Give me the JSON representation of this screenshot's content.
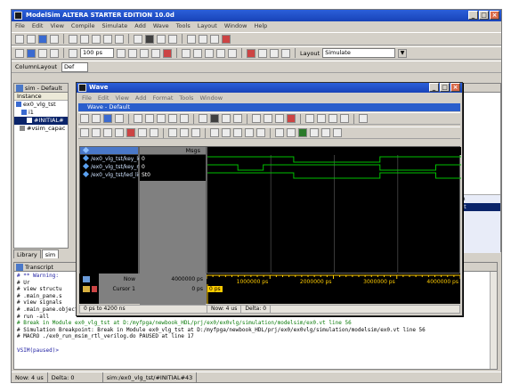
{
  "main": {
    "title": "ModelSim ALTERA STARTER EDITION 10.0d",
    "menu": [
      "File",
      "Edit",
      "View",
      "Compile",
      "Simulate",
      "Add",
      "Wave",
      "Tools",
      "Layout",
      "Window",
      "Help"
    ],
    "run_length": "100 ps",
    "layout_label": "Layout",
    "layout_value": "Simulate",
    "column_layout": "ColumnLayout",
    "column_layout_value": "Def"
  },
  "sim_pane": {
    "title": "sim - Default",
    "column": "Instance",
    "items": [
      "ex0_vlg_tst",
      "i1",
      "#INITIAL#",
      "#vsim_capac"
    ]
  },
  "left_tabs": [
    "Library",
    "sim"
  ],
  "right_pane": {
    "header": "ath",
    "row": "_tst"
  },
  "transcript": {
    "title": "Transcript",
    "lines": [
      {
        "text": "# ** Warning:",
        "cls": "blue"
      },
      {
        "text": "#           Ur",
        "cls": ""
      },
      {
        "text": "# view structu",
        "cls": ""
      },
      {
        "text": "# .main_pane.s",
        "cls": ""
      },
      {
        "text": "# view signals",
        "cls": ""
      },
      {
        "text": "# .main_pane.objects.interior.cs.body.tree",
        "cls": ""
      },
      {
        "text": "# run -all",
        "cls": ""
      },
      {
        "text": "# Break in Module ex0_vlg_tst at D:/myfpga/newbook_HDL/prj/ex0/ex0vlg/simulation/modelsim/ex0.vt line 56",
        "cls": "green"
      },
      {
        "text": "# Simulation Breakpoint: Break in Module ex0_vlg_tst at D:/myfpga/newbook_HDL/prj/ex0/ex0vlg/simulation/modelsim/ex0.vt line 56",
        "cls": ""
      },
      {
        "text": "# MACRO ./ex0_run_msim_rtl_verilog.do PAUSED at line 17",
        "cls": ""
      },
      {
        "text": "",
        "cls": ""
      },
      {
        "text": "VSIM(paused)>",
        "cls": "blue"
      }
    ]
  },
  "status": {
    "now": "Now: 4 us",
    "delta": "Delta: 0",
    "path": "sim:/ex0_vlg_tst/#INITIAL#43"
  },
  "wave": {
    "title": "Wave",
    "menu": [
      "File",
      "Edit",
      "View",
      "Add",
      "Format",
      "Tools",
      "Window"
    ],
    "subtitle": "Wave - Default",
    "msgs": "Msgs",
    "signals": [
      {
        "name": "/ex0_vlg_tst/key_left",
        "value": "0"
      },
      {
        "name": "/ex0_vlg_tst/key_ri...",
        "value": "0"
      },
      {
        "name": "/ex0_vlg_tst/led_light",
        "value": "St0"
      }
    ],
    "now_label": "Now",
    "now_value": "4000000 ps",
    "cursor_label": "Cursor 1",
    "cursor_value": "0 ps",
    "cursor_marker": "0 ps",
    "time_ticks": [
      "1000000 ps",
      "2000000 ps",
      "3000000 ps",
      "4000000 ps"
    ],
    "time_ticks_fraction": [
      0.25,
      0.5,
      0.75,
      1.0
    ],
    "range": "0 ps to 4200 ns",
    "bottom_now": "Now: 4 us",
    "bottom_delta": "Delta: 0"
  },
  "colors": {
    "titlebar": "#1843b8",
    "wave_green": "#00c000",
    "wave_bg": "#000000",
    "cursor_yellow": "#ffcc00"
  }
}
